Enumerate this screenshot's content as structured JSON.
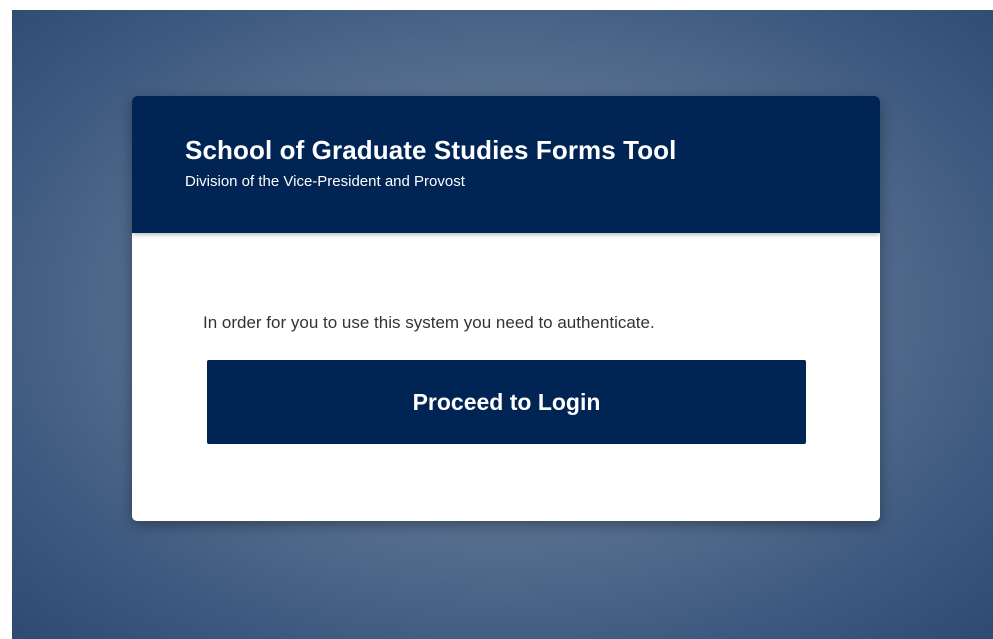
{
  "header": {
    "title": "School of Graduate Studies Forms Tool",
    "subtitle": "Division of the Vice-President and Provost"
  },
  "body": {
    "message": "In order for you to use this system you need to authenticate.",
    "login_button_label": "Proceed to Login"
  },
  "colors": {
    "brand_navy": "#002454",
    "background_gradient_center": "#7489a4",
    "background_gradient_edge": "#2f4a72",
    "card_background": "#ffffff"
  }
}
